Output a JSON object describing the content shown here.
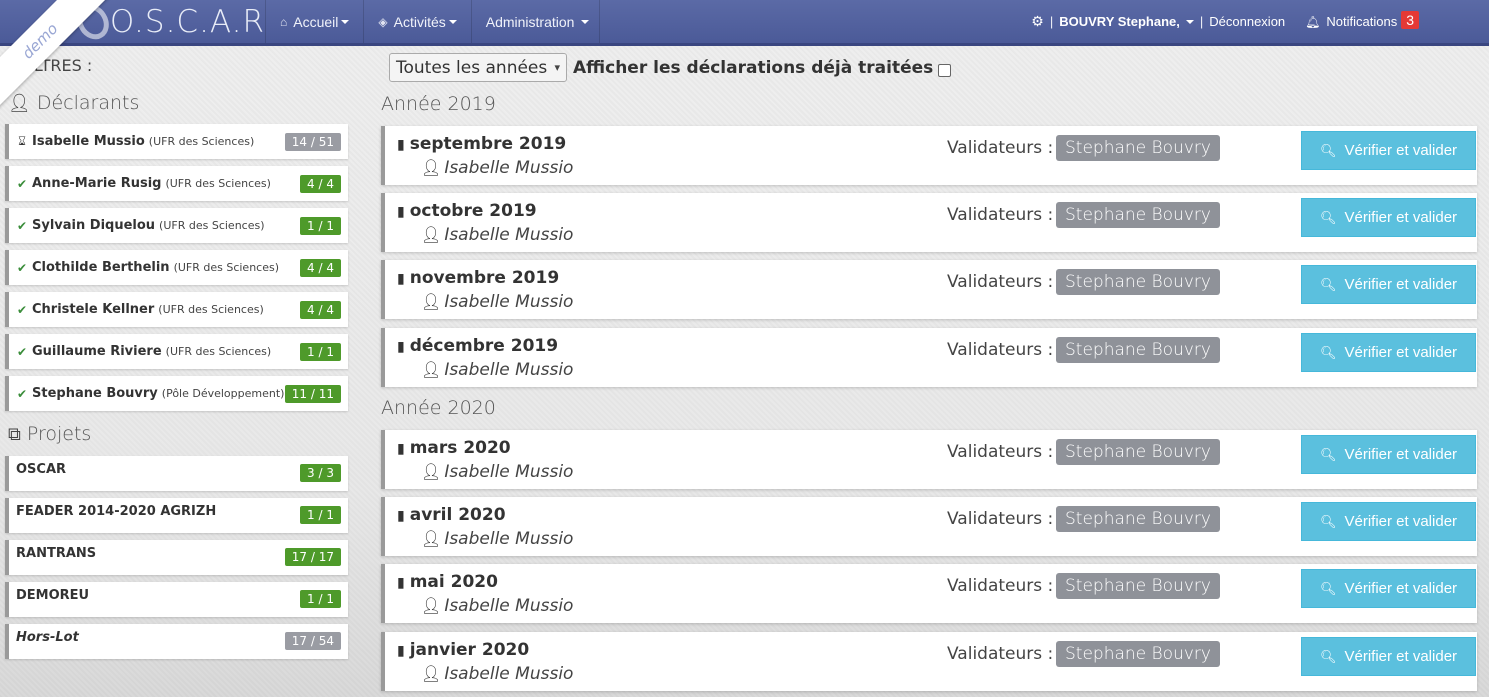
{
  "navbar": {
    "brand": "O.S.C.A.R",
    "demo_ribbon": "demo",
    "menus": [
      {
        "label": "Accueil",
        "icon": "home-icon",
        "glyph": "⌂"
      },
      {
        "label": "Activités",
        "icon": "cube-icon",
        "glyph": "◈"
      },
      {
        "label": "Administration",
        "icon": "",
        "glyph": ""
      }
    ],
    "settings_icon": "gear-icon",
    "user_name": "BOUVRY Stephane,",
    "logout_label": "Déconnexion",
    "notifications_label": "Notifications",
    "notifications_count": "3"
  },
  "filters": {
    "label": "FILTRES :",
    "year_select_value": "Toutes les années",
    "show_processed_label": "Afficher les déclarations déjà traitées"
  },
  "declarants": {
    "title": "Déclarants",
    "items": [
      {
        "name": "Isabelle Mussio",
        "org": "(UFR des Sciences)",
        "count": "14 / 51",
        "status": "pending",
        "count_color": "grey"
      },
      {
        "name": "Anne-Marie Rusig",
        "org": "(UFR des Sciences)",
        "count": "4 / 4",
        "status": "ok",
        "count_color": "green"
      },
      {
        "name": "Sylvain Diquelou",
        "org": "(UFR des Sciences)",
        "count": "1 / 1",
        "status": "ok",
        "count_color": "green"
      },
      {
        "name": "Clothilde Berthelin",
        "org": "(UFR des Sciences)",
        "count": "4 / 4",
        "status": "ok",
        "count_color": "green"
      },
      {
        "name": "Christele Kellner",
        "org": "(UFR des Sciences)",
        "count": "4 / 4",
        "status": "ok",
        "count_color": "green"
      },
      {
        "name": "Guillaume Riviere",
        "org": "(UFR des Sciences)",
        "count": "1 / 1",
        "status": "ok",
        "count_color": "green"
      },
      {
        "name": "Stephane Bouvry",
        "org": "(Pôle Développement)",
        "count": "11 / 11",
        "status": "ok",
        "count_color": "green"
      }
    ]
  },
  "projects": {
    "title": "Projets",
    "items": [
      {
        "name": "OSCAR",
        "count": "3 / 3",
        "count_color": "green",
        "italic": false
      },
      {
        "name": "FEADER 2014-2020 AGRIZH",
        "count": "1 / 1",
        "count_color": "green",
        "italic": false
      },
      {
        "name": "RANTRANS",
        "count": "17 / 17",
        "count_color": "green",
        "italic": false
      },
      {
        "name": "DEMOREU",
        "count": "1 / 1",
        "count_color": "green",
        "italic": false
      },
      {
        "name": "Hors-Lot",
        "count": "17 / 54",
        "count_color": "grey",
        "italic": true
      }
    ]
  },
  "years": [
    {
      "title": "Année 2019",
      "declarations": [
        {
          "period": "septembre 2019",
          "person": "Isabelle Mussio",
          "validators_label": "Validateurs :",
          "validator": "Stephane Bouvry",
          "action": "Vérifier et valider"
        },
        {
          "period": "octobre 2019",
          "person": "Isabelle Mussio",
          "validators_label": "Validateurs :",
          "validator": "Stephane Bouvry",
          "action": "Vérifier et valider"
        },
        {
          "period": "novembre 2019",
          "person": "Isabelle Mussio",
          "validators_label": "Validateurs :",
          "validator": "Stephane Bouvry",
          "action": "Vérifier et valider"
        },
        {
          "period": "décembre 2019",
          "person": "Isabelle Mussio",
          "validators_label": "Validateurs :",
          "validator": "Stephane Bouvry",
          "action": "Vérifier et valider"
        }
      ]
    },
    {
      "title": "Année 2020",
      "declarations": [
        {
          "period": "mars 2020",
          "person": "Isabelle Mussio",
          "validators_label": "Validateurs :",
          "validator": "Stephane Bouvry",
          "action": "Vérifier et valider"
        },
        {
          "period": "avril 2020",
          "person": "Isabelle Mussio",
          "validators_label": "Validateurs :",
          "validator": "Stephane Bouvry",
          "action": "Vérifier et valider"
        },
        {
          "period": "mai 2020",
          "person": "Isabelle Mussio",
          "validators_label": "Validateurs :",
          "validator": "Stephane Bouvry",
          "action": "Vérifier et valider"
        },
        {
          "period": "janvier 2020",
          "person": "Isabelle Mussio",
          "validators_label": "Validateurs :",
          "validator": "Stephane Bouvry",
          "action": "Vérifier et valider"
        }
      ]
    }
  ],
  "colors": {
    "navbar": "#4b5a98",
    "count_green": "#4e9a2a",
    "count_grey": "#9a9ca3",
    "verify_button": "#5bc0de",
    "validator_badge": "#8f9299",
    "notification_badge": "#e53935"
  }
}
